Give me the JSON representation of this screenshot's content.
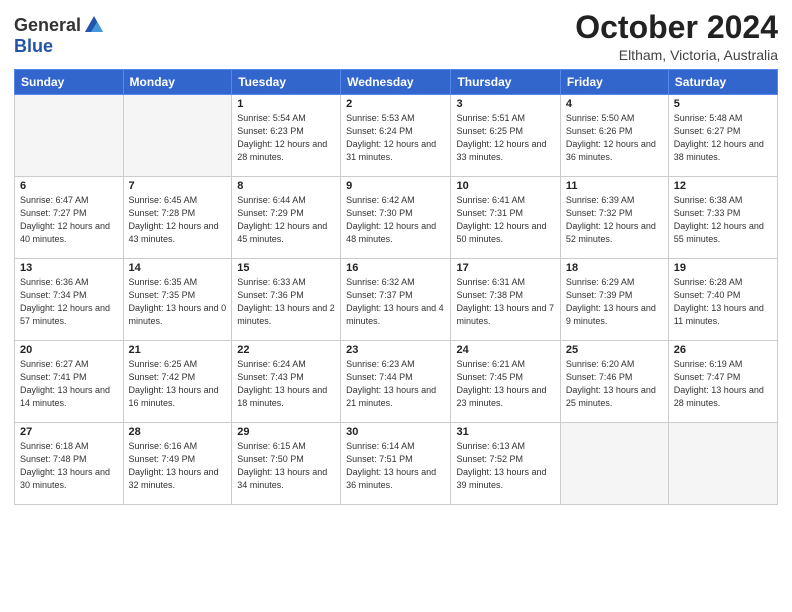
{
  "header": {
    "logo_general": "General",
    "logo_blue": "Blue",
    "month_title": "October 2024",
    "location": "Eltham, Victoria, Australia"
  },
  "days_of_week": [
    "Sunday",
    "Monday",
    "Tuesday",
    "Wednesday",
    "Thursday",
    "Friday",
    "Saturday"
  ],
  "weeks": [
    [
      {
        "day": "",
        "empty": true
      },
      {
        "day": "",
        "empty": true
      },
      {
        "day": "1",
        "sunrise": "5:54 AM",
        "sunset": "6:23 PM",
        "daylight": "12 hours and 28 minutes."
      },
      {
        "day": "2",
        "sunrise": "5:53 AM",
        "sunset": "6:24 PM",
        "daylight": "12 hours and 31 minutes."
      },
      {
        "day": "3",
        "sunrise": "5:51 AM",
        "sunset": "6:25 PM",
        "daylight": "12 hours and 33 minutes."
      },
      {
        "day": "4",
        "sunrise": "5:50 AM",
        "sunset": "6:26 PM",
        "daylight": "12 hours and 36 minutes."
      },
      {
        "day": "5",
        "sunrise": "5:48 AM",
        "sunset": "6:27 PM",
        "daylight": "12 hours and 38 minutes."
      }
    ],
    [
      {
        "day": "6",
        "sunrise": "6:47 AM",
        "sunset": "7:27 PM",
        "daylight": "12 hours and 40 minutes."
      },
      {
        "day": "7",
        "sunrise": "6:45 AM",
        "sunset": "7:28 PM",
        "daylight": "12 hours and 43 minutes."
      },
      {
        "day": "8",
        "sunrise": "6:44 AM",
        "sunset": "7:29 PM",
        "daylight": "12 hours and 45 minutes."
      },
      {
        "day": "9",
        "sunrise": "6:42 AM",
        "sunset": "7:30 PM",
        "daylight": "12 hours and 48 minutes."
      },
      {
        "day": "10",
        "sunrise": "6:41 AM",
        "sunset": "7:31 PM",
        "daylight": "12 hours and 50 minutes."
      },
      {
        "day": "11",
        "sunrise": "6:39 AM",
        "sunset": "7:32 PM",
        "daylight": "12 hours and 52 minutes."
      },
      {
        "day": "12",
        "sunrise": "6:38 AM",
        "sunset": "7:33 PM",
        "daylight": "12 hours and 55 minutes."
      }
    ],
    [
      {
        "day": "13",
        "sunrise": "6:36 AM",
        "sunset": "7:34 PM",
        "daylight": "12 hours and 57 minutes."
      },
      {
        "day": "14",
        "sunrise": "6:35 AM",
        "sunset": "7:35 PM",
        "daylight": "13 hours and 0 minutes."
      },
      {
        "day": "15",
        "sunrise": "6:33 AM",
        "sunset": "7:36 PM",
        "daylight": "13 hours and 2 minutes."
      },
      {
        "day": "16",
        "sunrise": "6:32 AM",
        "sunset": "7:37 PM",
        "daylight": "13 hours and 4 minutes."
      },
      {
        "day": "17",
        "sunrise": "6:31 AM",
        "sunset": "7:38 PM",
        "daylight": "13 hours and 7 minutes."
      },
      {
        "day": "18",
        "sunrise": "6:29 AM",
        "sunset": "7:39 PM",
        "daylight": "13 hours and 9 minutes."
      },
      {
        "day": "19",
        "sunrise": "6:28 AM",
        "sunset": "7:40 PM",
        "daylight": "13 hours and 11 minutes."
      }
    ],
    [
      {
        "day": "20",
        "sunrise": "6:27 AM",
        "sunset": "7:41 PM",
        "daylight": "13 hours and 14 minutes."
      },
      {
        "day": "21",
        "sunrise": "6:25 AM",
        "sunset": "7:42 PM",
        "daylight": "13 hours and 16 minutes."
      },
      {
        "day": "22",
        "sunrise": "6:24 AM",
        "sunset": "7:43 PM",
        "daylight": "13 hours and 18 minutes."
      },
      {
        "day": "23",
        "sunrise": "6:23 AM",
        "sunset": "7:44 PM",
        "daylight": "13 hours and 21 minutes."
      },
      {
        "day": "24",
        "sunrise": "6:21 AM",
        "sunset": "7:45 PM",
        "daylight": "13 hours and 23 minutes."
      },
      {
        "day": "25",
        "sunrise": "6:20 AM",
        "sunset": "7:46 PM",
        "daylight": "13 hours and 25 minutes."
      },
      {
        "day": "26",
        "sunrise": "6:19 AM",
        "sunset": "7:47 PM",
        "daylight": "13 hours and 28 minutes."
      }
    ],
    [
      {
        "day": "27",
        "sunrise": "6:18 AM",
        "sunset": "7:48 PM",
        "daylight": "13 hours and 30 minutes."
      },
      {
        "day": "28",
        "sunrise": "6:16 AM",
        "sunset": "7:49 PM",
        "daylight": "13 hours and 32 minutes."
      },
      {
        "day": "29",
        "sunrise": "6:15 AM",
        "sunset": "7:50 PM",
        "daylight": "13 hours and 34 minutes."
      },
      {
        "day": "30",
        "sunrise": "6:14 AM",
        "sunset": "7:51 PM",
        "daylight": "13 hours and 36 minutes."
      },
      {
        "day": "31",
        "sunrise": "6:13 AM",
        "sunset": "7:52 PM",
        "daylight": "13 hours and 39 minutes."
      },
      {
        "day": "",
        "empty": true
      },
      {
        "day": "",
        "empty": true
      }
    ]
  ],
  "labels": {
    "sunrise": "Sunrise:",
    "sunset": "Sunset:",
    "daylight": "Daylight:"
  }
}
